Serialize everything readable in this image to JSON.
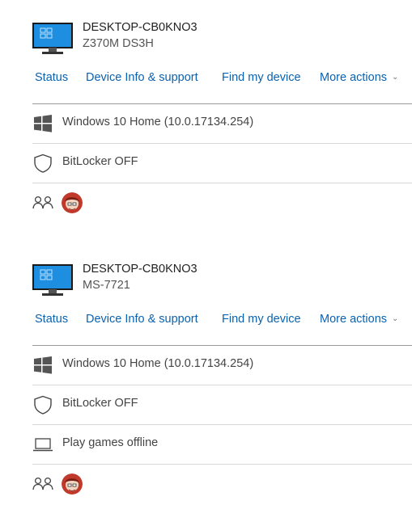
{
  "devices": [
    {
      "name": "DESKTOP-CB0KNO3",
      "model": "Z370M DS3H",
      "links": {
        "status": "Status",
        "device_info": "Device Info & support",
        "find_device": "Find my device",
        "more_actions": "More actions"
      },
      "os": "Windows 10 Home (10.0.17134.254)",
      "bitlocker": "BitLocker OFF"
    },
    {
      "name": "DESKTOP-CB0KNO3",
      "model": "MS-7721",
      "links": {
        "status": "Status",
        "device_info": "Device Info & support",
        "find_device": "Find my device",
        "more_actions": "More actions"
      },
      "os": "Windows 10 Home (10.0.17134.254)",
      "bitlocker": "BitLocker OFF",
      "games": "Play games offline"
    }
  ],
  "icons": {
    "monitor": "monitor-icon",
    "windows": "windows-logo-icon",
    "shield": "shield-icon",
    "laptop": "laptop-icon",
    "people": "people-icon",
    "avatar": "user-avatar",
    "chevron": "chevron-down-icon"
  },
  "colors": {
    "link": "#0a62b0",
    "monitor_screen": "#1e8fe0",
    "divider": "#d8d8d8",
    "accent_divider": "#9a9a9a"
  }
}
